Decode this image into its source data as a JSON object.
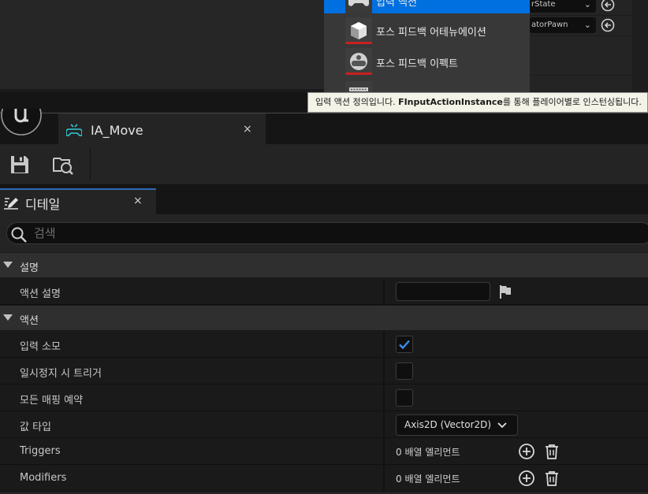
{
  "background_editor": {
    "combo_values": [
      "rState",
      "atorPawn"
    ],
    "popup_menu": {
      "items": [
        {
          "label": "입력 액션",
          "selected": true
        },
        {
          "label": "포스 피드백 어테뉴에이션",
          "selected": false
        },
        {
          "label": "포스 피드백 이펙트",
          "selected": false
        }
      ]
    },
    "tooltip": {
      "prefix": "입력 액션 정의입니다. ",
      "bold": "FInputActionInstance",
      "suffix": "를 통해 플레이어별로 인스턴싱됩니다."
    }
  },
  "window": {
    "tab": {
      "title": "IA_Move",
      "close": "×"
    },
    "toolbar": {
      "save_icon": "save-icon",
      "browse_icon": "browse-asset-icon"
    },
    "details_tab": {
      "label": "디테일",
      "close": "×"
    },
    "search": {
      "placeholder": "검색",
      "value": ""
    },
    "categories": [
      {
        "label": "설명",
        "properties": [
          {
            "name": "액션 설명",
            "type": "text",
            "value": ""
          }
        ]
      },
      {
        "label": "액션",
        "properties": [
          {
            "name": "입력 소모",
            "type": "checkbox",
            "checked": true
          },
          {
            "name": "일시정지 시 트리거",
            "type": "checkbox",
            "checked": false
          },
          {
            "name": "모든 매핑 예약",
            "type": "checkbox",
            "checked": false
          },
          {
            "name": "값 타입",
            "type": "dropdown",
            "value": "Axis2D (Vector2D)"
          },
          {
            "name": "Triggers",
            "type": "array",
            "value": "0 배열 엘리먼트"
          },
          {
            "name": "Modifiers",
            "type": "array",
            "value": "0 배열 엘리먼트"
          }
        ]
      }
    ]
  },
  "colors": {
    "accent": "#0070e0",
    "check": "#3b8ee8",
    "tab_icon": "#32c8d8"
  }
}
